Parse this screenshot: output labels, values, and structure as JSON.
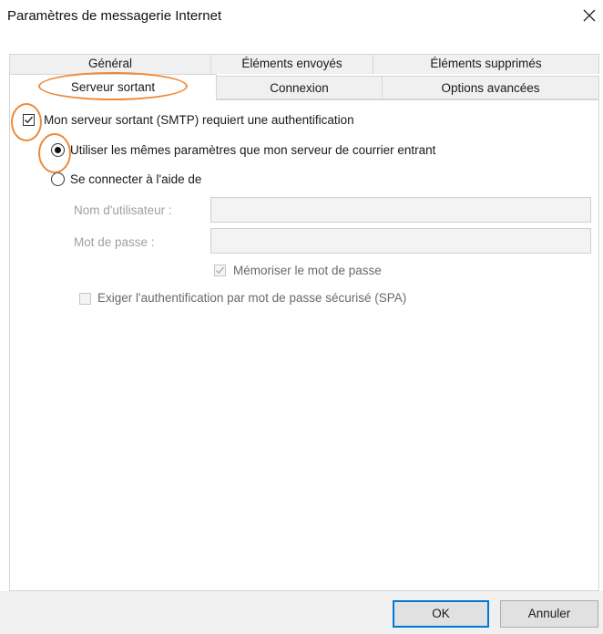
{
  "window": {
    "title": "Paramètres de messagerie Internet",
    "close_icon": "close-icon"
  },
  "tabs": {
    "row1": [
      {
        "label": "Général"
      },
      {
        "label": "Éléments envoyés"
      },
      {
        "label": "Éléments supprimés"
      }
    ],
    "row2": [
      {
        "label": "Serveur sortant",
        "selected": true
      },
      {
        "label": "Connexion"
      },
      {
        "label": "Options avancées"
      }
    ]
  },
  "smtp": {
    "auth_required_label": "Mon serveur sortant (SMTP) requiert une authentification",
    "auth_required_checked": true,
    "use_same_label": "Utiliser les mêmes paramètres que mon serveur de courrier entrant",
    "use_same_selected": true,
    "connect_with_label": "Se connecter à l'aide de",
    "connect_with_selected": false,
    "username_label": "Nom d'utilisateur :",
    "username_value": "",
    "password_label": "Mot de passe :",
    "password_value": "",
    "remember_password_label": "Mémoriser le mot de passe",
    "remember_password_checked": true,
    "spa_label": "Exiger l'authentification par mot de passe sécurisé (SPA)",
    "spa_checked": false
  },
  "buttons": {
    "ok": "OK",
    "cancel": "Annuler"
  },
  "colors": {
    "highlight_annotation": "#ee8a3a",
    "default_button_border": "#0078d7",
    "disabled_text": "#a0a0a0"
  }
}
